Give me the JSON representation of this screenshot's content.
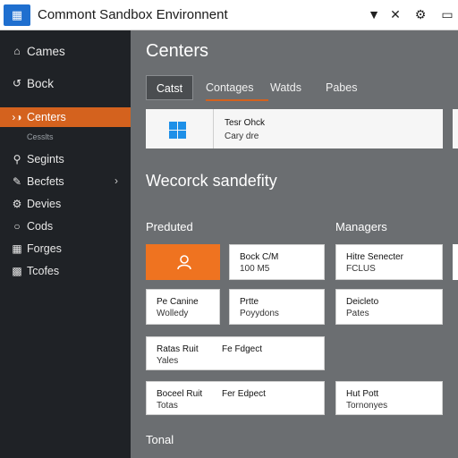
{
  "window": {
    "title": "Commont Sandbox Environnent",
    "app_icon_glyph": "Ὕ4",
    "controls": {
      "minimize": "▼",
      "close": "✕",
      "settings": "⚙",
      "restore": "❐"
    }
  },
  "sidebar": {
    "items": [
      {
        "label": "Cames",
        "icon": "home-icon",
        "glyph": "⌂"
      },
      {
        "label": "Bock",
        "icon": "back-icon",
        "glyph": "↺"
      },
      {
        "label": "Centers",
        "icon": "user-group-icon",
        "glyph": "⚑"
      },
      {
        "label": "Cesslts",
        "icon": "none"
      },
      {
        "label": "Segints",
        "icon": "location-pin-icon",
        "glyph": "✉"
      },
      {
        "label": "Becfets",
        "icon": "edit-icon",
        "glyph": "✎"
      },
      {
        "label": "Devies",
        "icon": "settings-icon",
        "glyph": "⚙"
      },
      {
        "label": "Cods",
        "icon": "chat-icon",
        "glyph": "○"
      },
      {
        "label": "Forges",
        "icon": "grid-icon",
        "glyph": "▦"
      },
      {
        "label": "Tcofes",
        "icon": "apps-icon",
        "glyph": "▦"
      }
    ]
  },
  "main": {
    "title": "Centers",
    "tabs": [
      "Catst",
      "Contages",
      "Watds",
      "Pabes"
    ],
    "detail_card": {
      "line1": "Tesr Ohck",
      "line2": "Cary dre"
    },
    "section_title": "Wecorck sandefity",
    "left_heading": "Preduted",
    "right_heading": "Managers",
    "tiles": [
      {
        "line1": "Bock C/M",
        "line2": "100 M5"
      },
      {
        "line1": "Hitre Senecter",
        "line2": "FCLUS"
      },
      {
        "line1": "Pe Canine",
        "line2": "Wolledy"
      },
      {
        "line1": "Prtte",
        "line2": "Poyydons"
      },
      {
        "line1": "Deicleto",
        "line2": "Pates"
      },
      {
        "line1": "Ratas Ruit",
        "line2": "Yales",
        "line3": "Fe Fdgect"
      },
      {
        "line1": "Boceel Ruit",
        "line2": "Totas",
        "line3": "Fer Edpect"
      },
      {
        "line1": "Hut Pott",
        "line2": "Tornonyes"
      }
    ],
    "footer_label": "Tonal"
  },
  "colors": {
    "accent": "#d4621e",
    "tile_orange": "#ef7320",
    "sidebar_bg": "#1f2226",
    "main_bg": "#6b6e71",
    "windows_blue": "#1e90e8"
  }
}
